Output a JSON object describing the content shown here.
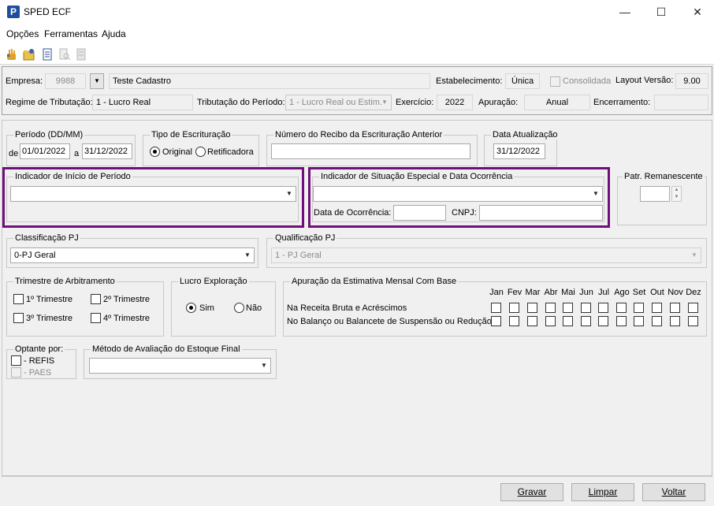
{
  "window": {
    "title": "SPED ECF",
    "icon_letter": "P"
  },
  "menu": [
    "Opções",
    "Ferramentas",
    "Ajuda"
  ],
  "toolbar_icons": [
    "hand-tool-icon",
    "settings-folder-icon",
    "document-icon",
    "search-document-icon",
    "report-icon"
  ],
  "header": {
    "empresa_label": "Empresa:",
    "empresa_code": "9988",
    "empresa_name": "Teste Cadastro",
    "estabelecimento_label": "Estabelecimento:",
    "estabelecimento_value": "Única",
    "consolidada_label": "Consolidada",
    "layout_label": "Layout Versão:",
    "layout_value": "9.00",
    "regime_label": "Regime de Tributação:",
    "regime_value": "1 - Lucro Real",
    "tributacao_label": "Tributação do Período:",
    "tributacao_value": "1 - Lucro Real ou Estim.",
    "exercicio_label": "Exercício:",
    "exercicio_value": "2022",
    "apuracao_label": "Apuração:",
    "apuracao_value": "Anual",
    "encerramento_label": "Encerramento:",
    "encerramento_value": ""
  },
  "periodo": {
    "title": "Período (DD/MM)",
    "de_label": "de",
    "de_value": "01/01/2022",
    "a_label": "a",
    "a_value": "31/12/2022"
  },
  "tipo_escrituracao": {
    "title": "Tipo de Escrituração",
    "original": "Original",
    "retificadora": "Retificadora",
    "selected": "Original"
  },
  "numero_recibo": {
    "title": "Número do Recibo da Escrituração Anterior",
    "value": ""
  },
  "data_atualizacao": {
    "title": "Data Atualização",
    "value": "31/12/2022"
  },
  "indicador_inicio": {
    "title": "Indicador de Início de Período",
    "value": ""
  },
  "indicador_situacao": {
    "title": "Indicador de Situação Especial e Data Ocorrência",
    "value": "",
    "data_label": "Data de Ocorrência:",
    "data_value": "",
    "cnpj_label": "CNPJ:",
    "cnpj_value": ""
  },
  "patr_remanescente": {
    "title": "Patr. Remanescente",
    "value": ""
  },
  "classificacao_pj": {
    "title": "Classificação PJ",
    "value": "0-PJ Geral"
  },
  "qualificacao_pj": {
    "title": "Qualificação PJ",
    "value": "1 - PJ Geral"
  },
  "trimestre": {
    "title": "Trimestre de Arbitramento",
    "items": [
      "1º Trimestre",
      "2º Trimestre",
      "3º Trimestre",
      "4º Trimestre"
    ]
  },
  "lucro_exploracao": {
    "title": "Lucro Exploração",
    "sim": "Sim",
    "nao": "Não",
    "selected": "Sim"
  },
  "apuracao_estimativa": {
    "title": "Apuração da Estimativa Mensal Com Base",
    "months": [
      "Jan",
      "Fev",
      "Mar",
      "Abr",
      "Mai",
      "Jun",
      "Jul",
      "Ago",
      "Set",
      "Out",
      "Nov",
      "Dez"
    ],
    "rows": [
      "Na Receita Bruta e Acréscimos",
      "No Balanço ou Balancete de Suspensão ou Redução"
    ]
  },
  "optante": {
    "title": "Optante por:",
    "refis": "- REFIS",
    "paes": "- PAES"
  },
  "metodo_estoque": {
    "title": "Método de Avaliação do Estoque Final",
    "value": ""
  },
  "buttons": {
    "gravar": "Gravar",
    "limpar": "Limpar",
    "voltar": "Voltar"
  },
  "colors": {
    "highlight": "#6f0f7c",
    "app_icon": "#1f4e9e"
  }
}
